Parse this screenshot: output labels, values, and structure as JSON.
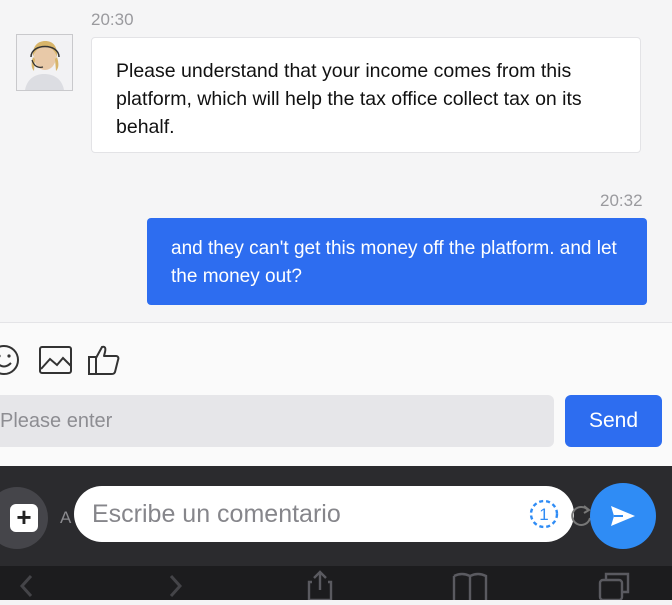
{
  "chat": {
    "incoming": {
      "time": "20:30",
      "text": "Please understand that your income comes from this platform, which will help the tax office collect tax on its behalf."
    },
    "outgoing": {
      "time": "20:32",
      "text": "and they can't get this money off the platform. and let the money out?"
    }
  },
  "toolbar": {
    "icons": [
      "emoji-icon",
      "image-icon",
      "thumbs-up-icon"
    ]
  },
  "composer": {
    "placeholder": "Please enter",
    "value": "",
    "send_label": "Send"
  },
  "comment_bar": {
    "ghost_letter": "A",
    "placeholder": "Escribe un comentario",
    "timer_label": "1"
  },
  "bottom_nav": {
    "icons": [
      "back-icon",
      "forward-icon",
      "share-icon",
      "bookmarks-icon",
      "tabs-icon"
    ]
  },
  "colors": {
    "accent": "#2d6df0",
    "fab": "#2f8cf5",
    "dark_bar": "#2b2b2e"
  }
}
